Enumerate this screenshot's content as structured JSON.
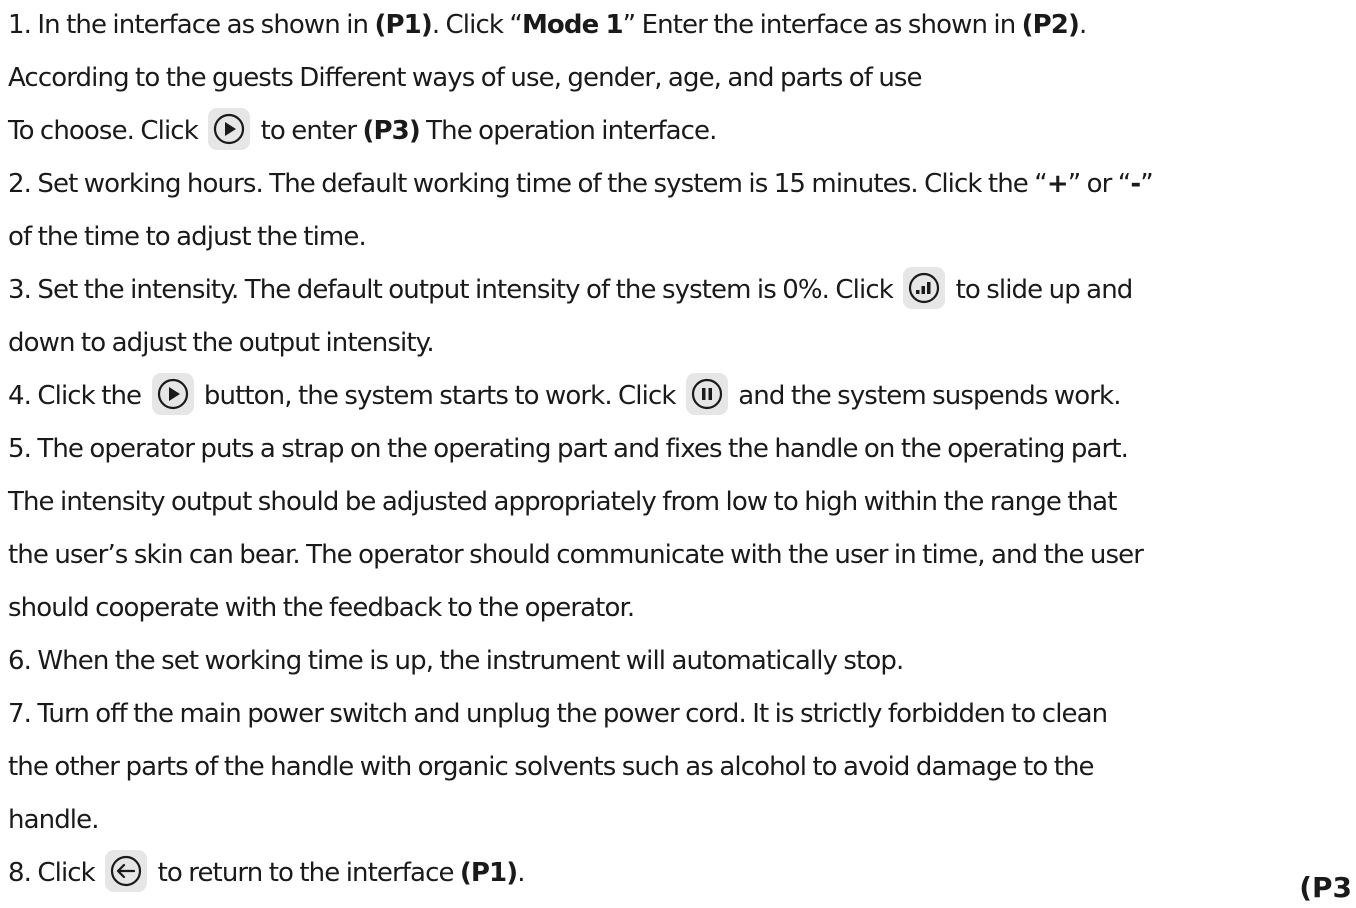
{
  "lines": {
    "l1": {
      "a": "1. In the interface as shown in ",
      "b": "(P1)",
      "c": ". Click “",
      "d": "Mode 1",
      "e": "” Enter the interface as shown in ",
      "f": "(P2)",
      "g": "."
    },
    "l2": "According to the guests Different ways of use, gender, age, and parts of use",
    "l3": {
      "a": "To choose. Click ",
      "b": " to enter ",
      "c": "(P3)",
      "d": " The operation interface."
    },
    "l4": {
      "a": "2. Set working hours. The default working time of the system is 15 minutes. Click the “",
      "b": "+",
      "c": "” or “",
      "d": "-",
      "e": "”"
    },
    "l5": "of the time to adjust the time.",
    "l6": {
      "a": "3. Set the intensity. The default output intensity of the system is 0%. Click ",
      "b": " to slide up and"
    },
    "l7": "down to adjust the output intensity.",
    "l8": {
      "a": "4. Click the ",
      "b": " button, the system starts to work. Click ",
      "c": " and the system suspends work."
    },
    "l9": "5. The operator puts a strap on the operating part and fixes the handle on the operating part.",
    "l10": "The intensity output should be adjusted appropriately from low to high within the range that",
    "l11": "the user’s skin can bear. The operator should communicate with the user in time, and the user",
    "l12": "should cooperate with the feedback to the operator.",
    "l13": "6. When the set working time is up, the instrument will automatically stop.",
    "l14": "7. Turn off the main power switch and unplug the power cord. It is strictly forbidden to clean",
    "l15": "the other parts of the handle with organic solvents such as alcohol to avoid damage to the",
    "l16": "handle.",
    "l17": {
      "a": "8. Click ",
      "b": " to return to the interface ",
      "c": "(P1)",
      "d": "."
    }
  },
  "corner_label": "(P3",
  "icons": [
    "play-icon",
    "signal-icon",
    "pause-icon",
    "back-arrow-icon"
  ],
  "colors": {
    "text": "#1a1a1a",
    "icon_bg": "#e6e6e6"
  }
}
